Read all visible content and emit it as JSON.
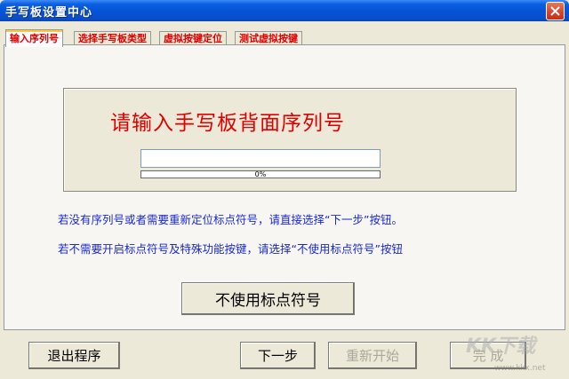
{
  "window": {
    "title": "手写板设置中心"
  },
  "tabs": [
    {
      "label": "输入序列号",
      "active": true
    },
    {
      "label": "选择手写板类型",
      "active": false
    },
    {
      "label": "虚拟按键定位",
      "active": false
    },
    {
      "label": "测试虚拟按键",
      "active": false
    }
  ],
  "serial": {
    "heading": "请输入手写板背面序列号",
    "input_value": "",
    "progress_text": "0%",
    "progress_fraction": 0
  },
  "hints": [
    "若没有序列号或者需要重新定位标点符号，请直接选择“下一步”按钮。",
    "若不需要开启标点符号及特殊功能按键，请选择“不使用标点符号”按钮"
  ],
  "buttons": {
    "no_punctuation": "不使用标点符号",
    "exit": "退出程序",
    "next": "下一步",
    "restart": "重新开始",
    "finish": "完 成"
  },
  "watermark": {
    "logo": "KK下载",
    "url": "www.kkx.net"
  },
  "colors": {
    "title_bar": "#0552d6",
    "tab_text": "#e00000",
    "hint_text": "#1a2ad6",
    "heading_text": "#e00000"
  }
}
